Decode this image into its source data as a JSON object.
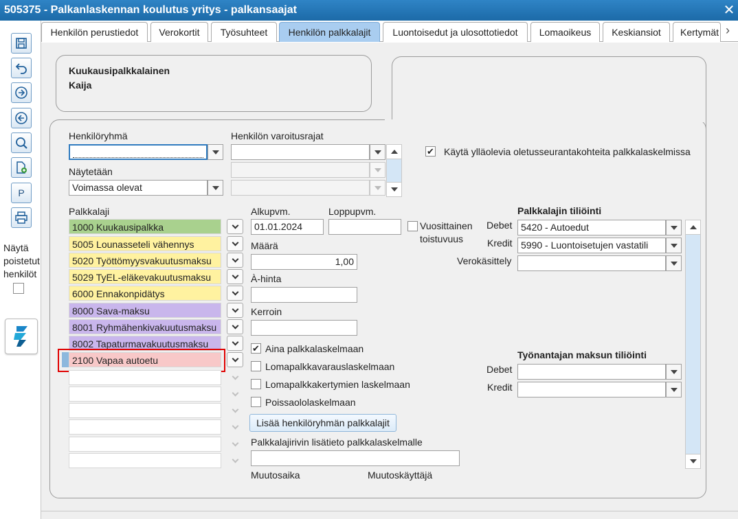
{
  "window": {
    "title": "505375 - Palkanlaskennan koulutus yritys - palkansaajat",
    "close_glyph": "✕"
  },
  "toolbar": {
    "buttons": [
      {
        "name": "save-button",
        "icon": "save-icon"
      },
      {
        "name": "undo-button",
        "icon": "undo-icon"
      },
      {
        "name": "next-button",
        "icon": "arrow-right-circle-icon"
      },
      {
        "name": "previous-button",
        "icon": "arrow-left-circle-icon"
      },
      {
        "name": "search-button",
        "icon": "magnifier-icon"
      },
      {
        "name": "new-document-button",
        "icon": "document-add-icon"
      },
      {
        "name": "p-button",
        "label": "P"
      },
      {
        "name": "print-button",
        "icon": "printer-icon"
      }
    ],
    "show_deleted_label_1": "Näytä",
    "show_deleted_label_2": "poistetut",
    "show_deleted_label_3": "henkilöt"
  },
  "tabs": [
    {
      "label": "Henkilön perustiedot"
    },
    {
      "label": "Verokortit"
    },
    {
      "label": "Työsuhteet"
    },
    {
      "label": "Henkilön palkkalajit",
      "active": true
    },
    {
      "label": "Luontoisedut ja ulosottotiedot"
    },
    {
      "label": "Lomaoikeus"
    },
    {
      "label": "Keskiansiot"
    },
    {
      "label": "Kertymät"
    }
  ],
  "person": {
    "name_line_1": "Kuukausipalkkalainen",
    "name_line_2": "Kaija"
  },
  "form": {
    "henkiloryhma_label": "Henkilöryhmä",
    "henkiloryhma_value": "",
    "varoitusrajat_label": "Henkilön varoitusrajat",
    "naytetaan_label": "Näytetään",
    "naytetaan_value": "Voimassa olevat",
    "default_tracking_label": "Käytä ylläolevia oletusseurantakohteita palkkalaskelmissa",
    "default_tracking_checked": true,
    "palkkalaji_label": "Palkkalaji",
    "palkkalajit": [
      {
        "label": "1000 Kuukausipalkka",
        "color": "#a9d18e"
      },
      {
        "label": "5005 Lounasseteli vähennys",
        "color": "#fff2a0"
      },
      {
        "label": "5020 Työttömyysvakuutusmaksu",
        "color": "#fff2a0"
      },
      {
        "label": "5029 TyEL-eläkevakuutusmaksu",
        "color": "#fff2a0"
      },
      {
        "label": "6000 Ennakonpidätys",
        "color": "#fff2a0"
      },
      {
        "label": "8000 Sava-maksu",
        "color": "#c9b6ec"
      },
      {
        "label": "8001 Ryhmähenkivakuutusmaksu",
        "color": "#c9b6ec"
      },
      {
        "label": "8002 Tapaturmavakuutusmaksu",
        "color": "#c9b6ec"
      },
      {
        "label": "2100 Vapaa autoetu",
        "color": "#f8c8c8",
        "selected": true
      }
    ],
    "alkupvm_label": "Alkupvm.",
    "alkupvm_value": "01.01.2024",
    "loppupvm_label": "Loppupvm.",
    "loppupvm_value": "",
    "vuosittainen_label_1": "Vuosittainen",
    "vuosittainen_label_2": "toistuvuus",
    "maara_label": "Määrä",
    "maara_value": "1,00",
    "ahinta_label": "À-hinta",
    "ahinta_value": "",
    "kerroin_label": "Kerroin",
    "kerroin_value": "",
    "checks": [
      {
        "label": "Aina palkkalaskelmaan",
        "checked": true
      },
      {
        "label": "Lomapalkkavarauslaskelmaan",
        "checked": false
      },
      {
        "label": "Lomapalkkakertymien laskelmaan",
        "checked": false
      },
      {
        "label": "Poissaololaskelmaan",
        "checked": false
      }
    ],
    "add_group_button": "Lisää henkilöryhmän palkkalajit",
    "lisatieto_label": "Palkkalajirivin lisätieto palkkalaskelmalle",
    "lisatieto_value": "",
    "muutosaika_label": "Muutosaika",
    "muutoskayttaja_label": "Muutoskäyttäjä",
    "tiliointi_title": "Palkkalajin tiliöinti",
    "debet_label": "Debet",
    "debet_value": "5420 - Autoedut",
    "kredit_label": "Kredit",
    "kredit_value": "5990 - Luontoisetujen vastatili",
    "verokasittely_label": "Verokäsittely",
    "verokasittely_value": "",
    "employer_title": "Työnantajan maksun tiliöinti",
    "emp_debet_label": "Debet",
    "emp_debet_value": "",
    "emp_kredit_label": "Kredit",
    "emp_kredit_value": ""
  }
}
